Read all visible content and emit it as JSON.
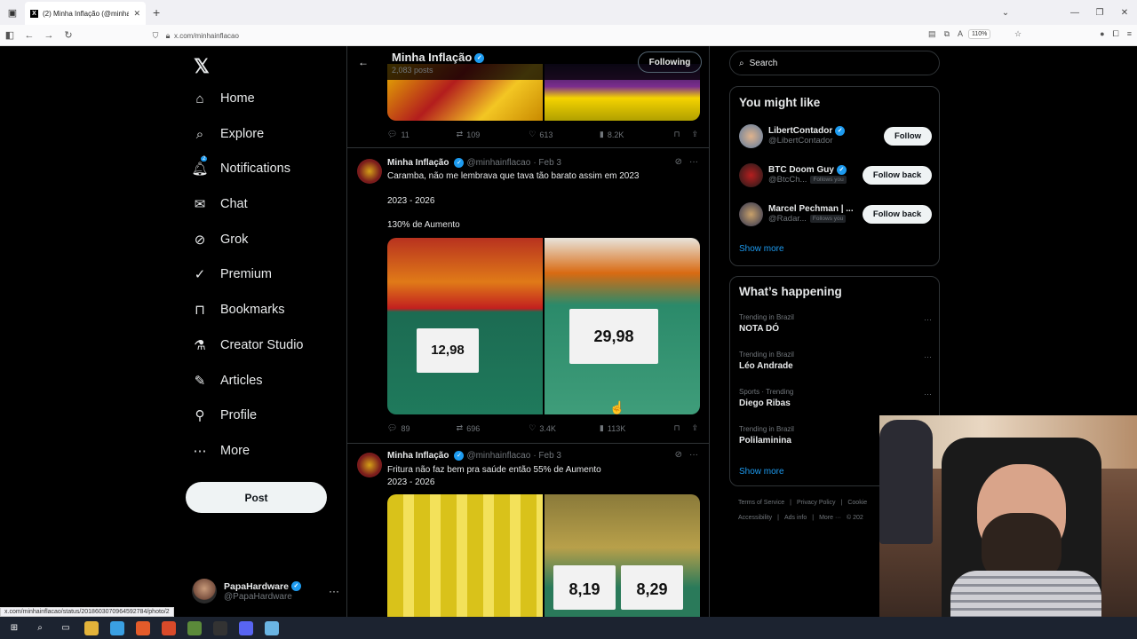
{
  "browser": {
    "tab_title": "(2) Minha Inflação (@minhainfl...",
    "url": "x.com/minhainflacao",
    "zoom": "110%",
    "status_url": "x.com/minhainflacao/status/2018603070964592784/photo/2"
  },
  "nav": {
    "items": [
      {
        "label": "Home",
        "icon": "home-icon"
      },
      {
        "label": "Explore",
        "icon": "search-icon"
      },
      {
        "label": "Notifications",
        "icon": "bell-icon",
        "badge": "2"
      },
      {
        "label": "Chat",
        "icon": "mail-icon"
      },
      {
        "label": "Grok",
        "icon": "grok-icon"
      },
      {
        "label": "Premium",
        "icon": "premium-icon"
      },
      {
        "label": "Bookmarks",
        "icon": "bookmark-icon"
      },
      {
        "label": "Creator Studio",
        "icon": "flask-icon"
      },
      {
        "label": "Articles",
        "icon": "article-icon"
      },
      {
        "label": "Profile",
        "icon": "person-icon"
      },
      {
        "label": "More",
        "icon": "more-circle-icon"
      }
    ],
    "post_label": "Post",
    "account_name": "PapaHardware",
    "account_handle": "@PapaHardware"
  },
  "profile": {
    "name": "Minha Inflação",
    "posts": "2,083 posts",
    "following_label": "Following"
  },
  "tweets": [
    {
      "stats": {
        "replies": "11",
        "reposts": "109",
        "likes": "613",
        "views": "8.2K"
      }
    },
    {
      "name": "Minha Inflação",
      "handle": "@minhainflacao",
      "date": "· Feb 3",
      "lines": [
        "Caramba,  não me lembrava que tava tão barato assim em 2023",
        "2023 - 2026",
        "130% de Aumento"
      ],
      "prices": [
        "12,98",
        "29,98"
      ],
      "stats": {
        "replies": "89",
        "reposts": "696",
        "likes": "3.4K",
        "views": "113K"
      }
    },
    {
      "name": "Minha Inflação",
      "handle": "@minhainflacao",
      "date": "· Feb 3",
      "lines": [
        "Fritura não faz bem pra saúde então 55% de Aumento",
        "2023 - 2026"
      ],
      "prices": [
        "8,19",
        "8,29"
      ]
    }
  ],
  "right": {
    "search_placeholder": "Search",
    "you_might_like": "You might like",
    "suggestions": [
      {
        "name": "LibertContador",
        "handle": "@LibertContador",
        "button": "Follow",
        "follows_you": ""
      },
      {
        "name": "BTC Doom Guy",
        "handle": "@BtcCh...",
        "button": "Follow back",
        "follows_you": "Follows you"
      },
      {
        "name": "Marcel Pechman | ...",
        "handle": "@Radar...",
        "button": "Follow back",
        "follows_you": "Follows you"
      }
    ],
    "show_more": "Show more",
    "whats_happening": "What’s happening",
    "trends": [
      {
        "context": "Trending in Brazil",
        "name": "NOTA DÓ"
      },
      {
        "context": "Trending in Brazil",
        "name": "Léo Andrade"
      },
      {
        "context": "Sports · Trending",
        "name": "Diego Ribas"
      },
      {
        "context": "Trending in Brazil",
        "name": "Polilaminina"
      }
    ],
    "footer_row1": [
      "Terms of Service",
      "|",
      "Privacy Policy",
      "|",
      "Cookie"
    ],
    "footer_row2": [
      "Accessibility",
      "|",
      "Ads info",
      "|",
      "More ···",
      "© 202"
    ]
  }
}
